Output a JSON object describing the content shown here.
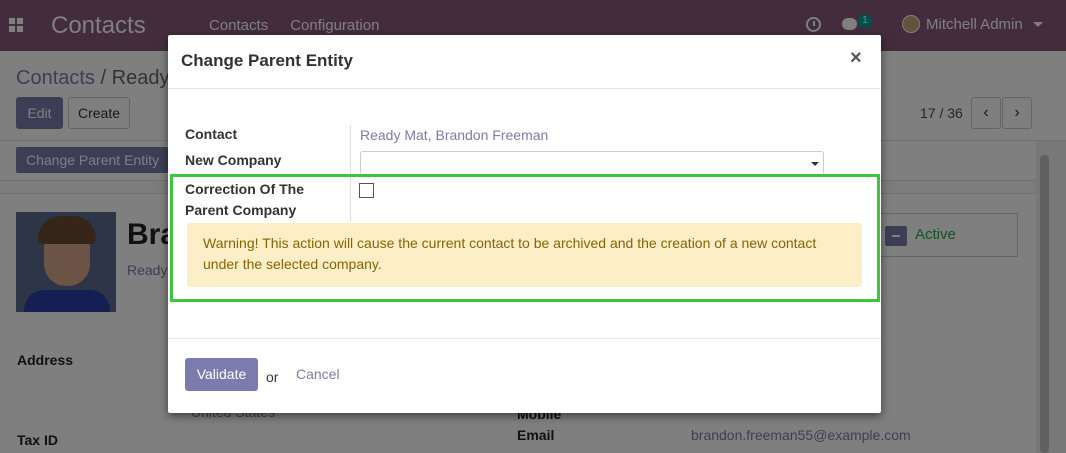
{
  "navbar": {
    "app_title": "Contacts",
    "menu": [
      "Contacts",
      "Configuration"
    ],
    "chat_count": "1",
    "user_name": "Mitchell Admin"
  },
  "control_panel": {
    "breadcrumb_root": "Contacts",
    "breadcrumb_sep": "/",
    "breadcrumb_current": "Ready",
    "edit_label": "Edit",
    "create_label": "Create",
    "pager": "17 / 36",
    "prev_icon": "‹",
    "next_icon": "›"
  },
  "statusbar": {
    "change_parent_label": "Change Parent Entity"
  },
  "form": {
    "name_partial": "Bra",
    "company_partial": "Ready",
    "active_label": "Active",
    "address_label": "Address",
    "tax_id_label": "Tax ID",
    "country_partial": "United States",
    "mobile_label": "Mobile",
    "email_label": "Email",
    "email_value": "brandon.freeman55@example.com"
  },
  "modal": {
    "title": "Change Parent Entity",
    "close_icon": "×",
    "contact_label": "Contact",
    "contact_value": "Ready Mat, Brandon Freeman",
    "new_company_label": "New Company",
    "new_company_value": "",
    "correction_label_line1": "Correction Of The",
    "correction_label_line2": "Parent Company",
    "correction_checked": false,
    "warning_text": "Warning! This action will cause the current contact to be archived and the creation of a new contact under the selected company.",
    "validate_label": "Validate",
    "or_label": "or",
    "cancel_label": "Cancel"
  },
  "colors": {
    "navbar": "#875a7b",
    "primary": "#7c7bad",
    "highlight": "#3bc63b",
    "warning_bg": "#fcefc8",
    "warning_text": "#856404",
    "active": "#28a745"
  }
}
